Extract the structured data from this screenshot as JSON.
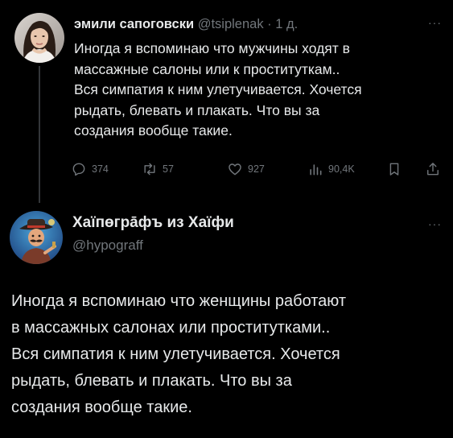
{
  "original_tweet": {
    "author_name": "эмили сапоговски",
    "author_handle": "@tsiplenak",
    "separator": "·",
    "time": "1 д.",
    "more_label": "···",
    "text_lines": [
      "Иногда я вспоминаю что мужчины ходят в",
      "массажные салоны или к проституткам..",
      "Вся симпатия к ним улетучивается. Хочется",
      "рыдать, блевать и плакать. Что вы за",
      "создания вообще такие."
    ],
    "actions": {
      "reply_count": "374",
      "retweet_count": "57",
      "like_count": "927",
      "view_count": "90,4K"
    }
  },
  "reply_tweet": {
    "author_name": "Хаїпөгрāфъ из Хаїфи",
    "author_handle": "@hypograff",
    "more_label": "···",
    "text_lines": [
      "Иногда я вспоминаю что женщины работают",
      "в массажных салонах или проститутками..",
      "Вся симпатия к ним улетучивается. Хочется",
      "рыдать, блевать и плакать. Что вы за",
      "создания вообще такие."
    ]
  },
  "icons": {
    "reply": "reply-icon",
    "retweet": "retweet-icon",
    "like": "heart-icon",
    "views": "views-icon",
    "bookmark": "bookmark-icon",
    "share": "share-icon",
    "more": "more-icon"
  },
  "colors": {
    "background": "#000000",
    "primary_text": "#e7e9ea",
    "secondary_text": "#71767b",
    "thread_line": "#333639"
  }
}
